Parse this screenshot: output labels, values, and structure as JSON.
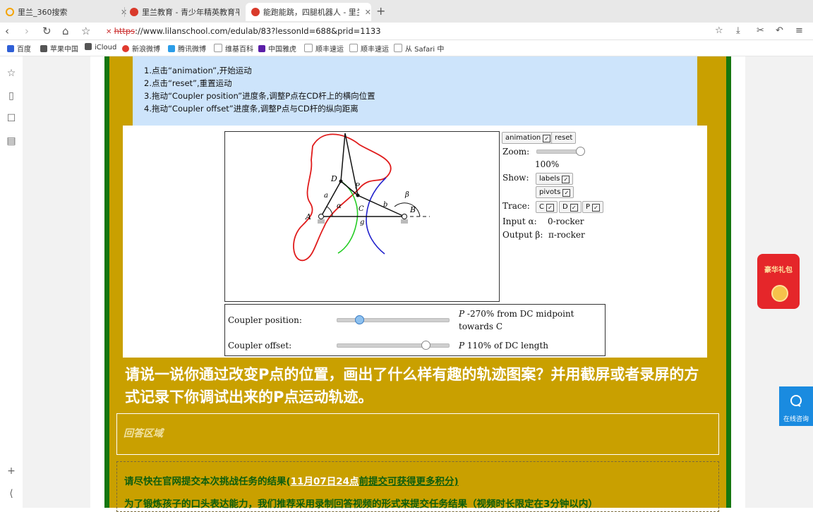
{
  "browser": {
    "tabs": [
      {
        "label": "里兰_360搜索"
      },
      {
        "label": "里兰教育 - 青少年精英教育平台"
      },
      {
        "label": "能跑能跳，四腿机器人 - 里兰教育"
      }
    ],
    "url_scheme": "https",
    "url_rest": "://www.lilanschool.com/edulab/83?lessonId=688&prid=1133",
    "bookmarks": [
      "百度",
      "苹果中国",
      "iCloud",
      "新浪微博",
      "腾讯微博",
      "维基百科",
      "中国雅虎",
      "顺丰速运",
      "顺丰速运",
      "从 Safari 中"
    ]
  },
  "instructions": [
    "1.点击“animation”,开始运动",
    "2.点击“reset”,重置运动",
    "3.拖动“Coupler position”进度条,调整P点在CD杆上的横向位置",
    "4.拖动“Coupler offset”进度条,调整P点与CD杆的纵向距离"
  ],
  "sim": {
    "animation_label": "animation",
    "reset_label": "reset",
    "zoom_label": "Zoom:",
    "zoom_value": 1.0,
    "zoom_text": "100%",
    "show_label": "Show:",
    "labels_label": "labels",
    "pivots_label": "pivots",
    "trace_label": "Trace:",
    "trace_c": "C",
    "trace_d": "D",
    "trace_p": "P",
    "input_label": "Input α:",
    "input_value": "0-rocker",
    "output_label": "Output β:",
    "output_value": "π-rocker",
    "diagram_labels": {
      "A": "A",
      "B": "B",
      "C": "C",
      "D": "D",
      "P": "P",
      "a": "a",
      "b": "b",
      "g": "g",
      "alpha": "α",
      "beta": "β"
    },
    "coupler_position_label": "Coupler position:",
    "coupler_position_value": 0.2,
    "coupler_position_desc": "-270% from DC midpoint towards C",
    "coupler_position_desc_1": "-270% from DC midpoint",
    "coupler_position_desc_2": "towards C",
    "coupler_offset_label": "Coupler offset:",
    "coupler_offset_value": 0.8,
    "coupler_offset_desc": "110% of DC length",
    "p_symbol": "P"
  },
  "question": "请说一说你通过改变P点的位置，画出了什么样有趣的轨迹图案？并用截屏或者录屏的方式记录下你调试出来的P点运动轨迹。",
  "answer_area": "回答区域",
  "notice": {
    "line1_a": "请尽快在官网提交本次挑战任务的结果(",
    "line1_date": "11月07日24点",
    "line1_b": "前提交可获得更多积分)",
    "line2": "为了锻炼孩子的口头表达能力，我们推荐采用录制回答视频的形式来提交任务结果（视频时长限定在3分钟以内）"
  },
  "floating": {
    "redpack_text": "豪华礼包",
    "consult_text": "在线咨询"
  }
}
